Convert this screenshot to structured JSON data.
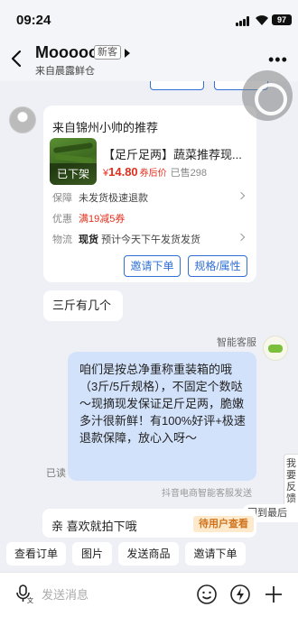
{
  "status_bar": {
    "time": "09:24",
    "battery": "97"
  },
  "header": {
    "title": "Mooooo",
    "badge": "新客",
    "subtitle": "来自晨露鲜仓"
  },
  "product_card": {
    "header": "来自锦州小帅的推荐",
    "offshelf_label": "已下架",
    "name": "【足斤足两】蔬菜推荐现...",
    "price_symbol": "¥",
    "price": "14.80",
    "coupon_note": "券后价",
    "sold": "已售298",
    "rows": [
      {
        "label": "保障",
        "value": "未发货极速退款"
      },
      {
        "label": "优惠",
        "value": "满19减5券"
      },
      {
        "label": "物流",
        "value_bold": "现货",
        "value": "预计今天下午发货发货"
      }
    ],
    "buttons": {
      "invite": "邀请下单",
      "spec": "规格/属性"
    }
  },
  "user_message": "三斤有几个",
  "agent": {
    "label": "智能客服",
    "message": "咱们是按总净重称重装箱的哦（3斤/5斤规格），不固定个数哒～现摘现发保证足斤足两，脆嫩多汁很新鲜！有100%好评+极速退款保障，放心入呀～",
    "read": "已读",
    "sent_by": "抖音电商智能客服发送"
  },
  "side": {
    "feedback": "我要反馈",
    "back_latest": "回到最后"
  },
  "quick_message": {
    "text": "亲 喜欢就拍下哦",
    "badge": "待用户查看"
  },
  "quick_actions": [
    "查看订单",
    "图片",
    "发送商品",
    "邀请下单"
  ],
  "input": {
    "placeholder": "发送消息"
  },
  "colors": {
    "accent_blue": "#2f6fd6",
    "price_red": "#e0301e",
    "agent_bubble": "#d3e2fb",
    "background": "#eef0f5"
  }
}
